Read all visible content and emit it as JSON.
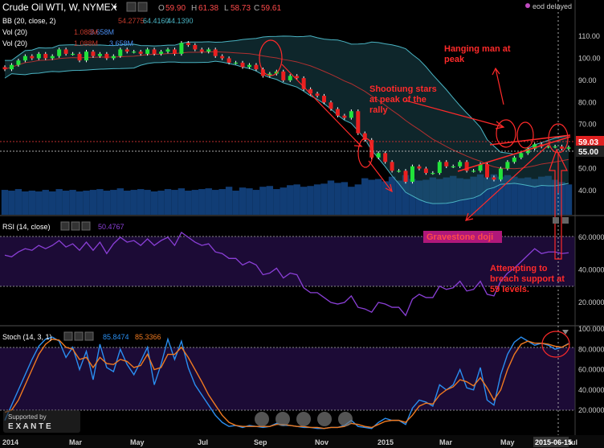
{
  "header": {
    "symbol": "Crude Oil WTI, W, NYMEX",
    "ohlc": {
      "O_label": "O",
      "O": "59.90",
      "H_label": "H",
      "H": "61.38",
      "L_label": "L",
      "L": "58.73",
      "C_label": "C",
      "C": "59.61"
    },
    "delay_note": "eod delayed"
  },
  "indicators": {
    "bb": {
      "label": "BB (20, close, 2)",
      "v1": "54.2775",
      "v2": "64.4160",
      "v3": "44.1390"
    },
    "vol1": {
      "label": "Vol (20)",
      "v1": "3.658M",
      "v2": "1.088M"
    },
    "vol2": {
      "label": "Vol (20)",
      "v1": "1.088M",
      "v2": "3.658M"
    }
  },
  "price_badges": {
    "last": "59.03",
    "support": "55.00"
  },
  "annotations": {
    "hanging_man": "Hanging man at\npeak",
    "shooting_stars": "Shootiung stars\nat peak of the\nrally",
    "gravestone": "Gravestone doji",
    "attempting": "Attempting to\nbreach support at\n59 levels."
  },
  "rsi": {
    "label": "RSI (14, close)",
    "value": "50.4767"
  },
  "stoch": {
    "label": "Stoch (14, 3, 1)",
    "k_value": "85.8474",
    "d_value": "85.3366"
  },
  "watermark": {
    "line1": "Supported by",
    "line2": "E X A N T E"
  },
  "x_axis": {
    "labels": [
      "2014",
      "Mar",
      "May",
      "Jul",
      "Sep",
      "Nov",
      "2015",
      "Mar",
      "May",
      "Jul"
    ],
    "current_date": "2015-06-15"
  },
  "colors": {
    "up": "#21e33a",
    "down": "#e82020",
    "bb": "#4ab3c2",
    "ma": "#b03030",
    "rsi": "#8a3fd6",
    "stoch_k": "#2a8ef0",
    "stoch_d": "#f07a20",
    "annotation": "#ff2a2a",
    "volume": "#1f6fd6"
  },
  "chart_data": [
    {
      "type": "candlestick",
      "title": "Crude Oil WTI, W, NYMEX",
      "ylim": [
        40,
        115
      ],
      "y_ticks": [
        "110.00",
        "100.00",
        "90.00",
        "80.00",
        "70.00",
        "60.00",
        "50.00",
        "40.00"
      ],
      "open": [
        96,
        95,
        97,
        99,
        101,
        100,
        102,
        100,
        101,
        104,
        102,
        102,
        99,
        103,
        101,
        102,
        100,
        101,
        104,
        103,
        103,
        102,
        104,
        102,
        103,
        104,
        102,
        107,
        106,
        104,
        103,
        104,
        101,
        100,
        98,
        98,
        96,
        97,
        95,
        92,
        93,
        94,
        90,
        92,
        91,
        86,
        84,
        83,
        80,
        77,
        74,
        73,
        76,
        66,
        63,
        55,
        57,
        53,
        49,
        49,
        44,
        51,
        50,
        48,
        48,
        53,
        51,
        51,
        53,
        49,
        49,
        52,
        46,
        45,
        50,
        53,
        55,
        57,
        59,
        61,
        60,
        60,
        60,
        59
      ],
      "close": [
        95,
        97,
        99,
        101,
        100,
        102,
        100,
        101,
        104,
        102,
        102,
        99,
        103,
        101,
        102,
        100,
        101,
        104,
        103,
        103,
        102,
        104,
        102,
        103,
        104,
        102,
        107,
        106,
        104,
        103,
        104,
        101,
        100,
        98,
        98,
        96,
        97,
        95,
        92,
        93,
        94,
        90,
        92,
        91,
        86,
        84,
        83,
        80,
        77,
        74,
        73,
        76,
        66,
        63,
        55,
        57,
        53,
        49,
        49,
        44,
        51,
        50,
        48,
        48,
        53,
        51,
        51,
        53,
        49,
        49,
        52,
        46,
        45,
        50,
        53,
        55,
        57,
        59,
        61,
        60,
        60,
        60,
        59,
        59.6
      ],
      "volume": [
        3.2,
        3.1,
        3.3,
        3.0,
        3.1,
        3.0,
        3.2,
        3.0,
        3.3,
        3.1,
        3.2,
        3.0,
        3.1,
        3.2,
        3.3,
        3.1,
        3.2,
        3.4,
        3.1,
        3.2,
        3.3,
        3.2,
        3.0,
        3.1,
        3.3,
        3.2,
        3.4,
        3.1,
        3.2,
        3.3,
        3.4,
        3.2,
        3.3,
        3.6,
        3.1,
        3.5,
        3.4,
        3.2,
        3.6,
        3.7,
        3.3,
        3.5,
        3.8,
        3.9,
        3.6,
        3.7,
        3.9,
        4.0,
        4.4,
        4.1,
        4.2,
        3.6,
        3.9,
        4.7,
        4.5,
        4.6,
        4.3,
        4.9,
        4.4,
        5.1,
        4.6,
        4.4,
        4.5,
        4.8,
        4.6,
        4.8,
        5.0,
        4.7,
        4.6,
        4.9,
        5.2,
        4.8,
        5.2,
        4.9,
        5.1,
        4.9,
        4.7,
        4.8,
        4.6,
        4.9,
        5.0,
        4.5,
        4.2,
        3.9
      ]
    },
    {
      "type": "line",
      "title": "RSI (14, close)",
      "ylim": [
        0,
        75
      ],
      "y_ticks": [
        "60.0000",
        "40.0000",
        "20.0000"
      ],
      "series": [
        {
          "name": "RSI",
          "values": [
            49,
            48,
            51,
            53,
            52,
            55,
            53,
            55,
            58,
            54,
            56,
            52,
            57,
            52,
            57,
            50,
            56,
            60,
            57,
            58,
            55,
            59,
            55,
            58,
            60,
            55,
            63,
            60,
            57,
            55,
            56,
            51,
            50,
            47,
            47,
            43,
            45,
            43,
            37,
            38,
            41,
            35,
            38,
            37,
            29,
            26,
            26,
            23,
            20,
            19,
            20,
            24,
            17,
            16,
            14,
            20,
            19,
            17,
            17,
            12,
            22,
            25,
            23,
            23,
            30,
            28,
            29,
            33,
            27,
            28,
            33,
            25,
            24,
            33,
            38,
            41,
            45,
            49,
            53,
            50,
            51,
            51,
            50,
            50.5
          ]
        }
      ]
    },
    {
      "type": "line",
      "title": "Stoch (14, 3, 1)",
      "ylim": [
        -5,
        105
      ],
      "y_ticks": [
        "100.0000",
        "80.0000",
        "60.0000",
        "40.0000",
        "20.0000"
      ],
      "series": [
        {
          "name": "%K",
          "values": [
            10,
            25,
            40,
            55,
            70,
            83,
            90,
            92,
            88,
            72,
            82,
            60,
            78,
            50,
            85,
            62,
            58,
            80,
            65,
            55,
            68,
            82,
            45,
            65,
            90,
            70,
            88,
            62,
            45,
            35,
            25,
            15,
            8,
            4,
            5,
            3,
            5,
            4,
            3,
            4,
            7,
            5,
            5,
            4,
            3,
            3,
            2,
            2,
            3,
            3,
            5,
            10,
            4,
            3,
            2,
            8,
            12,
            10,
            10,
            6,
            22,
            30,
            28,
            24,
            45,
            40,
            45,
            60,
            42,
            40,
            62,
            30,
            25,
            55,
            75,
            87,
            92,
            88,
            84,
            86,
            84,
            80,
            82,
            85.8
          ]
        },
        {
          "name": "%D",
          "values": [
            18,
            20,
            30,
            45,
            60,
            75,
            85,
            90,
            89,
            82,
            80,
            70,
            72,
            62,
            72,
            66,
            65,
            70,
            68,
            62,
            64,
            75,
            60,
            62,
            75,
            75,
            82,
            72,
            60,
            48,
            35,
            25,
            15,
            8,
            5,
            4,
            4,
            4,
            4,
            4,
            6,
            6,
            5,
            4,
            4,
            3,
            3,
            2,
            3,
            3,
            4,
            7,
            6,
            4,
            3,
            6,
            9,
            10,
            10,
            8,
            15,
            24,
            27,
            26,
            35,
            40,
            43,
            50,
            48,
            44,
            52,
            42,
            30,
            40,
            60,
            75,
            85,
            88,
            86,
            86,
            85,
            83,
            82,
            85.3
          ]
        }
      ]
    }
  ]
}
